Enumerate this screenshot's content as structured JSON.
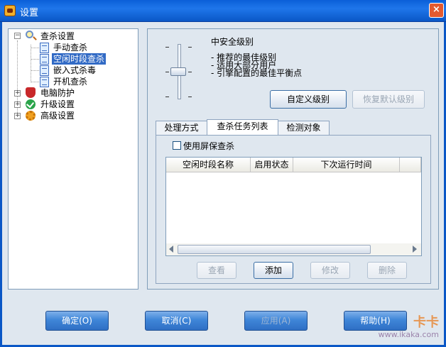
{
  "window": {
    "title": "设置",
    "close_label": "×"
  },
  "tree": [
    {
      "label": "查杀设置",
      "expander": "−"
    },
    {
      "label": "手动查杀"
    },
    {
      "label": "空闲时段查杀",
      "selected": true
    },
    {
      "label": "嵌入式杀毒"
    },
    {
      "label": "开机查杀"
    },
    {
      "label": "电脑防护",
      "expander": "+"
    },
    {
      "label": "升级设置",
      "expander": "+"
    },
    {
      "label": "高级设置",
      "expander": "+"
    }
  ],
  "level": {
    "title": "中安全级别",
    "desc": [
      "- 推荐的最佳级别",
      "- 适用大部分用户",
      "- 引擎配置的最佳平衡点"
    ],
    "slider_position": "middle"
  },
  "buttons": {
    "custom_level": "自定义级别",
    "restore_default": "恢复默认级别"
  },
  "tabs": [
    "处理方式",
    "查杀任务列表",
    "检测对象"
  ],
  "task": {
    "screensaver_label": "使用屏保查杀",
    "columns": [
      "空闲时段名称",
      "启用状态",
      "下次运行时间"
    ],
    "actions": [
      "查看",
      "添加",
      "修改",
      "删除"
    ]
  },
  "footer": {
    "ok": "确定(O)",
    "cancel": "取消(C)",
    "apply": "应用(A)",
    "help": "帮助(H)"
  },
  "watermark": {
    "brand": "卡卡",
    "url": "www.ikaka.com"
  }
}
